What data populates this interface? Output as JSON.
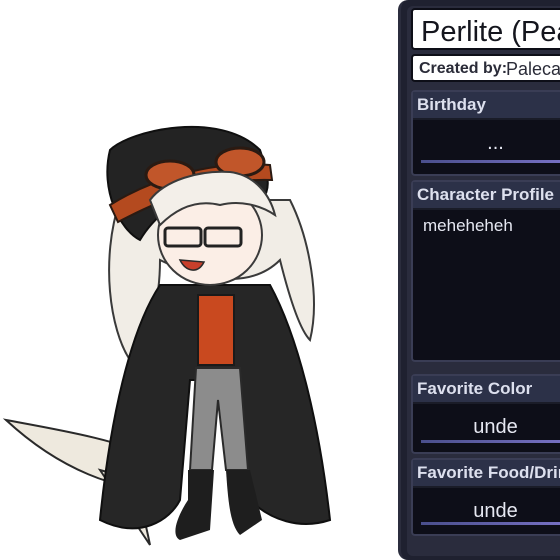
{
  "character": {
    "name": "Perlite (Pea",
    "created_label": "Created by:",
    "created_value": "Paleca"
  },
  "fields": {
    "birthday": {
      "label": "Birthday",
      "value": "..."
    },
    "profile": {
      "label": "Character Profile",
      "value": "meheheheh"
    },
    "favorite_color": {
      "label": "Favorite Color",
      "value": "unde"
    },
    "favorite_food": {
      "label": "Favorite Food/Drink",
      "value": "unde"
    }
  }
}
